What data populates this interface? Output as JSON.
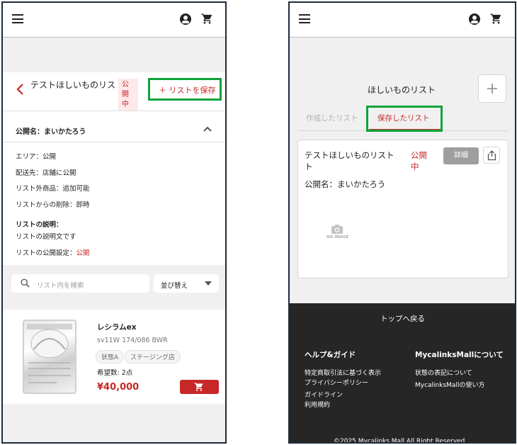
{
  "left": {
    "back_icon": "chevron-left-icon",
    "list_title": "テストほしいものリスト",
    "status_badge": [
      "公開",
      "中"
    ],
    "save_button": "＋ リストを保存",
    "public_name": "公開名：まいかたろう",
    "settings": [
      "エリア：公開",
      "配送先：店舗に公開",
      "リスト外商品：追加可能",
      "リストからの削除：即時"
    ],
    "description_heading": "リストの説明：",
    "description_text": "リストの説明文です",
    "visibility_label": "リストの公開設定：",
    "visibility_value": "公開",
    "search_placeholder": "リスト内を検索",
    "sort_label": "並び替え",
    "product": {
      "name": "レシラムex",
      "code": "sv11W 174/086 BWR",
      "chips": [
        "状態A",
        "ステージング店"
      ],
      "wanted": "希望数: 2点",
      "price": "¥40,000"
    }
  },
  "right": {
    "page_title": "ほしいものリスト",
    "tabs": [
      "作成したリスト",
      "保存したリスト"
    ],
    "active_tab": 1,
    "card": {
      "title_line1": "テストほしいものリスト",
      "title_line2": "ト",
      "status": [
        "公開",
        "中"
      ],
      "detail_button": "詳細",
      "public_name": "公開名：まいかたろう",
      "no_image": "NO IMAGE"
    },
    "footer": {
      "back_to_top": "トップへ戻る",
      "help_heading": "ヘルプ&ガイド",
      "help_links": [
        "特定商取引法に基づく表示",
        "プライバシーポリシー",
        "ガイドライン",
        "利用規約"
      ],
      "about_heading": "MycalinksMallについて",
      "about_links": [
        "状態の表記について",
        "MycalinksMallの使い方"
      ],
      "copyright": "©2025 Mycalinks Mall All Right Reserved"
    }
  },
  "colors": {
    "accent": "#c62828",
    "highlight": "#0fa33a",
    "footer": "#262626"
  }
}
